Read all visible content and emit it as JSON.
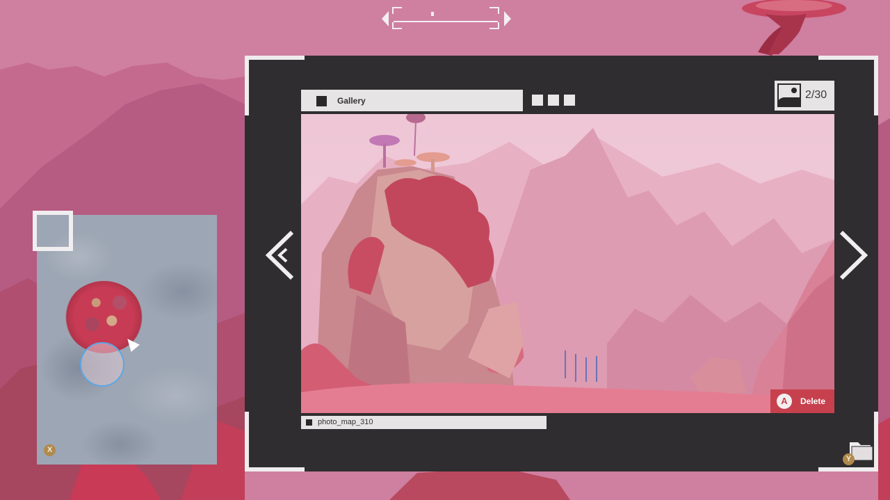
{
  "compass": {
    "marker_label": "compass-marker"
  },
  "minimap": {
    "button_hint": "X"
  },
  "gallery": {
    "title": "Gallery",
    "counter": "2/30",
    "filename": "photo_map_310",
    "delete": {
      "button_glyph": "A",
      "label": "Delete"
    },
    "folder_hint": "Y",
    "nav": {
      "prev_icon": "chevron-left-icon",
      "next_icon": "chevron-right-icon"
    }
  },
  "colors": {
    "frame": "#2f2d2f",
    "accent_delete": "#c7404e",
    "panel": "#e6e4e5",
    "button_hint": "#b08a4c"
  }
}
